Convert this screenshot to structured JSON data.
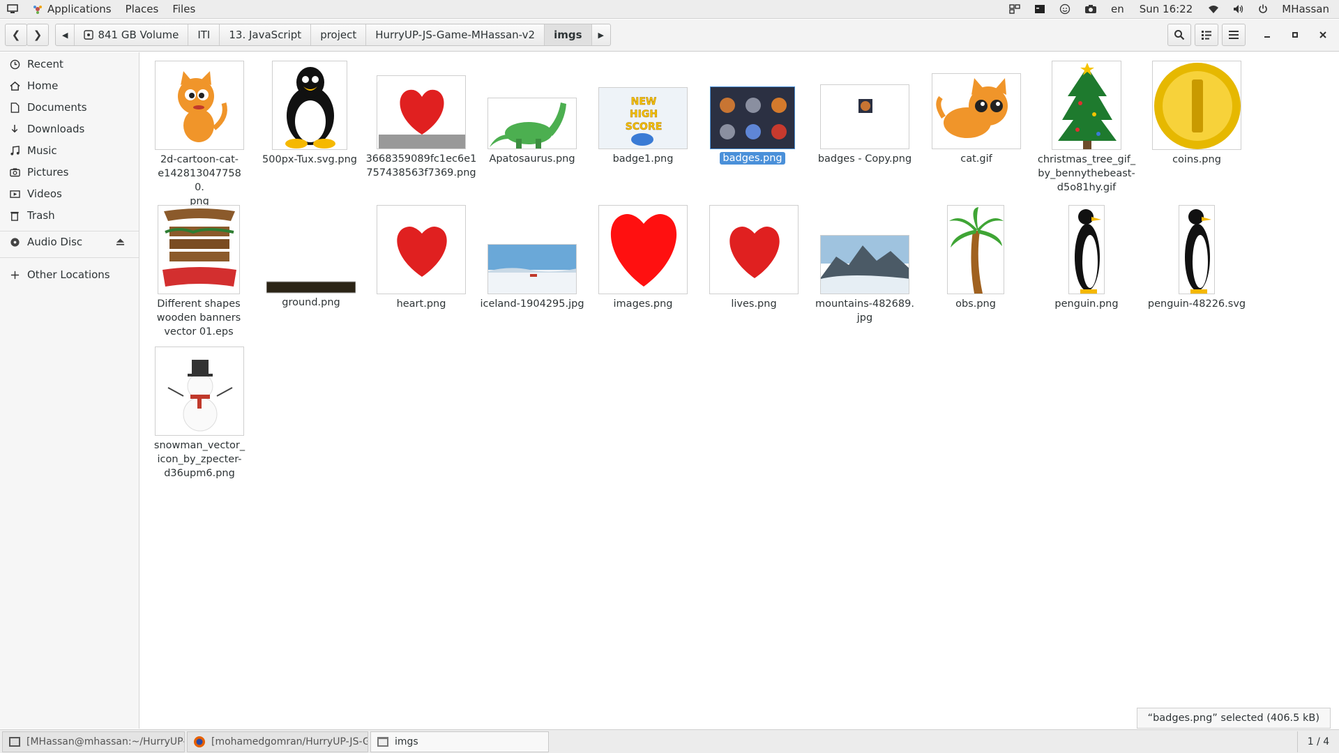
{
  "top_panel": {
    "applications_label": "Applications",
    "places_label": "Places",
    "files_label": "Files",
    "language": "en",
    "clock": "Sun 16:22",
    "user": "MHassan"
  },
  "path_bar": {
    "segments": [
      "841 GB Volume",
      "ITI",
      "13. JavaScript",
      "project",
      "HurryUP-JS-Game-MHassan-v2",
      "imgs"
    ]
  },
  "sidebar": {
    "items": [
      {
        "label": "Recent",
        "icon": "clock-icon"
      },
      {
        "label": "Home",
        "icon": "home-icon"
      },
      {
        "label": "Documents",
        "icon": "document-icon"
      },
      {
        "label": "Downloads",
        "icon": "download-icon"
      },
      {
        "label": "Music",
        "icon": "music-icon"
      },
      {
        "label": "Pictures",
        "icon": "camera-icon"
      },
      {
        "label": "Videos",
        "icon": "video-icon"
      },
      {
        "label": "Trash",
        "icon": "trash-icon"
      }
    ],
    "devices": [
      {
        "label": "Audio Disc",
        "icon": "disc-icon"
      }
    ],
    "other": [
      {
        "label": "Other Locations",
        "icon": "plus-icon"
      }
    ]
  },
  "files": [
    {
      "name": "2d-cartoon-cat-e1428130477580.png",
      "lines": [
        "2d-cartoon-cat-",
        "e1428130477580.",
        "png"
      ]
    },
    {
      "name": "500px-Tux.svg.png",
      "lines": [
        "500px-Tux.svg.png"
      ]
    },
    {
      "name": "3668359089fc1ec6e1757438563f7369.png",
      "lines": [
        "3668359089fc1ec6e1",
        "757438563f7369.png"
      ]
    },
    {
      "name": "Apatosaurus.png",
      "lines": [
        "Apatosaurus.png"
      ]
    },
    {
      "name": "badge1.png",
      "lines": [
        "badge1.png"
      ]
    },
    {
      "name": "badges.png",
      "lines": [
        "badges.png"
      ],
      "selected": true
    },
    {
      "name": "badges - Copy.png",
      "lines": [
        "badges - Copy.png"
      ]
    },
    {
      "name": "cat.gif",
      "lines": [
        "cat.gif"
      ]
    },
    {
      "name": "christmas_tree_gif_by_bennythebeast-d5o81hy.gif",
      "lines": [
        "christmas_tree_gif_",
        "by_bennythebeast-",
        "d5o81hy.gif"
      ]
    },
    {
      "name": "coins.png",
      "lines": [
        "coins.png"
      ]
    },
    {
      "name": "Different shapes wooden banners vector 01.eps",
      "lines": [
        "Different shapes",
        "wooden banners",
        "vector 01.eps"
      ]
    },
    {
      "name": "ground.png",
      "lines": [
        "ground.png"
      ]
    },
    {
      "name": "heart.png",
      "lines": [
        "heart.png"
      ]
    },
    {
      "name": "iceland-1904295.jpg",
      "lines": [
        "iceland-1904295.jpg"
      ]
    },
    {
      "name": "images.png",
      "lines": [
        "images.png"
      ]
    },
    {
      "name": "lives.png",
      "lines": [
        "lives.png"
      ]
    },
    {
      "name": "mountains-482689.jpg",
      "lines": [
        "mountains-482689.",
        "jpg"
      ]
    },
    {
      "name": "obs.png",
      "lines": [
        "obs.png"
      ]
    },
    {
      "name": "penguin.png",
      "lines": [
        "penguin.png"
      ]
    },
    {
      "name": "penguin-48226.svg",
      "lines": [
        "penguin-48226.svg"
      ]
    },
    {
      "name": "snowman_vector_icon_by_zpecter-d36upm6.png",
      "lines": [
        "snowman_vector_",
        "icon_by_zpecter-",
        "d36upm6.png"
      ]
    }
  ],
  "status": "“badges.png” selected  (406.5 kB)",
  "taskbar": {
    "tasks": [
      {
        "label": "[MHassan@mhassan:~/HurryUP-JS-...",
        "icon": "terminal-icon"
      },
      {
        "label": "[mohamedgomran/HurryUP-JS-Gam...",
        "icon": "firefox-icon"
      },
      {
        "label": "imgs",
        "icon": "files-icon",
        "active": true
      }
    ],
    "workspace": "1 / 4"
  }
}
